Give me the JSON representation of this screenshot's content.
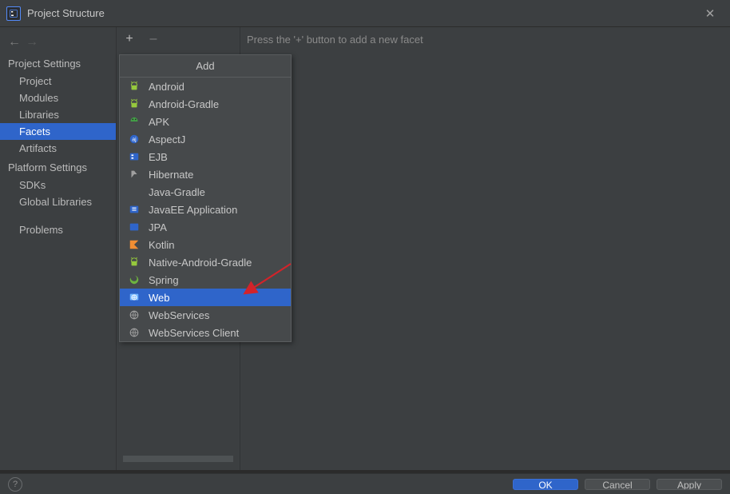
{
  "window": {
    "title": "Project Structure"
  },
  "sidebar": {
    "section1": "Project Settings",
    "items1": [
      "Project",
      "Modules",
      "Libraries",
      "Facets",
      "Artifacts"
    ],
    "section2": "Platform Settings",
    "items2": [
      "SDKs",
      "Global Libraries"
    ],
    "problems": "Problems",
    "selected": "Facets"
  },
  "toolbar": {
    "add": "+",
    "remove": "–"
  },
  "hint": "Press the '+' button to add a new facet",
  "dropdown": {
    "title": "Add",
    "items": [
      {
        "icon": "android",
        "label": "Android"
      },
      {
        "icon": "android",
        "label": "Android-Gradle"
      },
      {
        "icon": "apk",
        "label": "APK"
      },
      {
        "icon": "aspectj",
        "label": "AspectJ"
      },
      {
        "icon": "ejb",
        "label": "EJB"
      },
      {
        "icon": "hibernate",
        "label": "Hibernate"
      },
      {
        "icon": "blank",
        "label": "Java-Gradle"
      },
      {
        "icon": "javaee",
        "label": "JavaEE Application"
      },
      {
        "icon": "jpa",
        "label": "JPA"
      },
      {
        "icon": "kotlin",
        "label": "Kotlin"
      },
      {
        "icon": "android",
        "label": "Native-Android-Gradle"
      },
      {
        "icon": "spring",
        "label": "Spring"
      },
      {
        "icon": "web",
        "label": "Web",
        "selected": true
      },
      {
        "icon": "globe",
        "label": "WebServices"
      },
      {
        "icon": "globe",
        "label": "WebServices Client"
      }
    ]
  },
  "footer": {
    "ok": "OK",
    "cancel": "Cancel",
    "apply": "Apply"
  }
}
